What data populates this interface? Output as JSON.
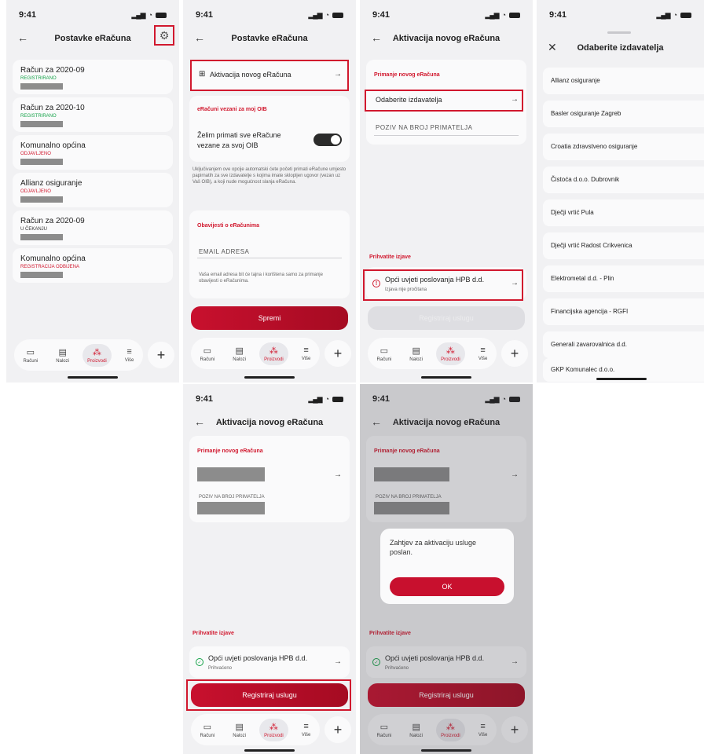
{
  "status": {
    "time": "9:41"
  },
  "tabbar": {
    "tabs": [
      "Računi",
      "Nalozi",
      "Proizvodi",
      "Više"
    ],
    "active": "Proizvodi",
    "plus": "+"
  },
  "screen1": {
    "title": "Postavke eRačuna",
    "items": [
      {
        "title": "Račun za 2020-09",
        "status": "REGISTRIRANO"
      },
      {
        "title": "Račun za 2020-10",
        "status": "REGISTRIRANO"
      },
      {
        "title": "Komunalno općina",
        "status": "ODJAVLJENO"
      },
      {
        "title": "Allianz osiguranje",
        "status": "ODJAVLJENO"
      },
      {
        "title": "Račun za 2020-09",
        "status": "U ČEKANJU"
      },
      {
        "title": "Komunalno općina",
        "status": "REGISTRACIJA ODBIJENA"
      }
    ]
  },
  "screen2": {
    "title": "Postavke eRačuna",
    "activate": "Aktivacija novog eRačuna",
    "oib_section": "eRačuni vezani za moj OIB",
    "oib_toggle_label": "Želim primati sve eRačune vezane za svoj OIB",
    "oib_info": "Uključivanjem ove opcije automatski ćete početi primati eRačune umjesto papirnatih za sve izdavatelje s kojima imate sklopljen ugovor (vezan uz Vaš OIB), a koji nude mogućnost slanja eRačuna.",
    "notif_section": "Obavijesti o eRačunima",
    "email_label": "EMAIL ADRESA",
    "email_info": "Vaša email adresa bit će tajna i korištena samo za primanje obavijesti o eRačunima.",
    "save": "Spremi"
  },
  "screen3": {
    "title": "Aktivacija novog eRačuna",
    "section": "Primanje novog eRačuna",
    "choose_issuer": "Odaberite izdavatelja",
    "ref_label": "POZIV NA BROJ PRIMATELJA",
    "accept_section": "Prihvatite izjave",
    "terms": "Opći uvjeti poslovanja HPB d.d.",
    "terms_status": "Izjava nije pročitana",
    "register": "Registriraj uslugu"
  },
  "screen4": {
    "title": "Odaberite izdavatelja",
    "issuers": [
      "Allianz osiguranje",
      "Basler osiguranje Zagreb",
      "Croatia zdravstveno osiguranje",
      "Čistoća d.o.o. Dubrovnik",
      "Dječji vrtić Pula",
      "Dječji vrtić Radost Crikvenica",
      "Elektrometal d.d. - Plin",
      "Financijska agencija - RGFI",
      "Generali zavarovalnica d.d.",
      "GKP Komunalec d.o.o."
    ]
  },
  "screen5": {
    "title": "Aktivacija novog eRačuna",
    "section": "Primanje novog eRačuna",
    "ref_label": "POZIV NA BROJ PRIMATELJA",
    "accept_section": "Prihvatite izjave",
    "terms": "Opći uvjeti poslovanja HPB d.d.",
    "terms_status": "Prihvaćeno",
    "register": "Registriraj uslugu"
  },
  "screen6": {
    "title": "Aktivacija novog eRačuna",
    "section": "Primanje novog eRačuna",
    "ref_label": "POZIV NA BROJ PRIMATELJA",
    "accept_section": "Prihvatite izjave",
    "terms": "Opći uvjeti poslovanja HPB d.d.",
    "terms_status": "Prihvaćeno",
    "register": "Registriraj uslugu",
    "dialog_text": "Zahtjev za aktivaciju usluge poslan.",
    "dialog_ok": "OK"
  }
}
